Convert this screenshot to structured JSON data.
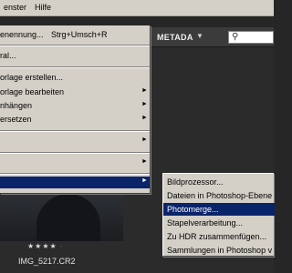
{
  "menubar": {
    "items": [
      "enster",
      "Hilfe"
    ]
  },
  "app": {
    "metadata_tab": "METADA",
    "search_icon": "search-icon"
  },
  "menu": {
    "items": [
      {
        "label": "enennung...",
        "shortcut": "Strg+Umsch+R"
      },
      {
        "label": "ral..."
      },
      {
        "label": "orlage erstellen..."
      },
      {
        "label": "orlage bearbeiten"
      },
      {
        "label": "nhängen"
      },
      {
        "label": "ersetzen"
      },
      {
        "label": ""
      },
      {
        "label": ""
      },
      {
        "label": ""
      }
    ]
  },
  "submenu": {
    "items": [
      {
        "label": "Bildprozessor..."
      },
      {
        "label": "Dateien in Photoshop-Ebene"
      },
      {
        "label": "Photomerge..."
      },
      {
        "label": "Stapelverarbeitung..."
      },
      {
        "label": "Zu HDR zusammenfügen..."
      },
      {
        "label": "Sammlungen in Photoshop v"
      }
    ]
  },
  "thumbnail": {
    "stars": "★★★★",
    "dot": "·",
    "filename": "IMG_5217.CR2"
  }
}
